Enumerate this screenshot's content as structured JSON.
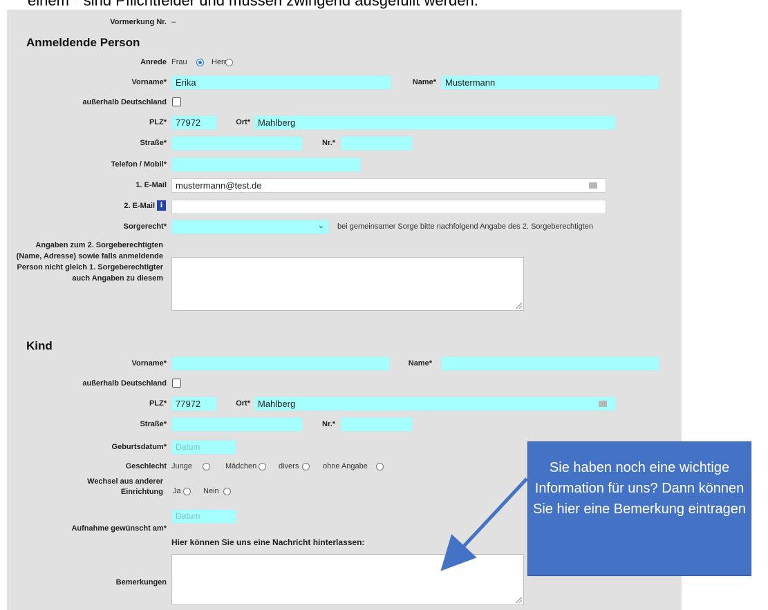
{
  "top_caption": "einem * sind Pflichtfelder und müssen zwingend ausgefüllt werden.",
  "vormerkung": {
    "label": "Vormerkung Nr.",
    "value": "–"
  },
  "sections": {
    "anmeldende": "Anmeldende Person",
    "kind": "Kind"
  },
  "person": {
    "anrede_label": "Anrede",
    "anrede_frau": "Frau",
    "anrede_herr": "Herr",
    "vorname_label": "Vorname*",
    "vorname_value": "Erika",
    "name_label": "Name*",
    "name_value": "Mustermann",
    "ausserhalb_label": "außerhalb Deutschland",
    "plz_label": "PLZ*",
    "plz_value": "77972",
    "ort_label": "Ort*",
    "ort_value": "Mahlberg",
    "strasse_label": "Straße*",
    "nr_label": "Nr.*",
    "telefon_label": "Telefon / Mobil*",
    "email1_label": "1. E-Mail",
    "email1_value": "mustermann@test.de",
    "email2_label": "2. E-Mail",
    "sorgerecht_label": "Sorgerecht*",
    "sorgerecht_hint": "bei gemeinsamer Sorge bitte nachfolgend Angabe des 2. Sorgeberechtigten",
    "angaben_label": "Angaben zum 2. Sorgeberechtigten (Name, Adresse) sowie falls anmeldende Person nicht gleich 1. Sorgeberechtigter auch Angaben zu diesem"
  },
  "kind": {
    "vorname_label": "Vorname*",
    "name_label": "Name*",
    "ausserhalb_label": "außerhalb Deutschland",
    "plz_label": "PLZ*",
    "plz_value": "77972",
    "ort_label": "Ort*",
    "ort_value": "Mahlberg",
    "strasse_label": "Straße*",
    "nr_label": "Nr.*",
    "geburtsdatum_label": "Geburtsdatum*",
    "datum_placeholder": "Datum",
    "geschlecht_label": "Geschlecht",
    "geschlecht_options": [
      "Junge",
      "Mädchen",
      "divers",
      "ohne Angabe"
    ],
    "wechsel_label": "Wechsel aus anderer Einrichtung",
    "wechsel_ja": "Ja",
    "wechsel_nein": "Nein",
    "aufnahme_label": "Aufnahme gewünscht am*",
    "nachricht_heading": "Hier können Sie uns eine Nachricht hinterlassen:",
    "bemerkungen_label": "Bemerkungen"
  },
  "callout": {
    "text": "Sie haben noch eine wichtige Information für uns? Dann können Sie hier eine Bemerkung eintragen"
  },
  "colors": {
    "required_field": "#a6ffff",
    "panel": "#e1e1e1",
    "callout": "#4472c4"
  }
}
